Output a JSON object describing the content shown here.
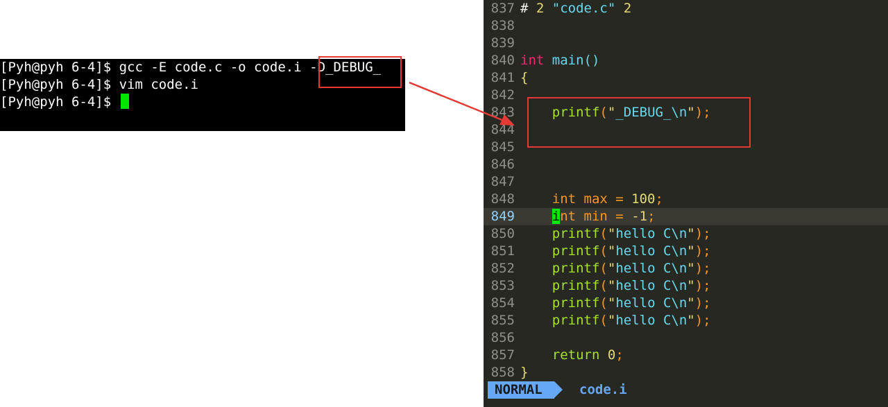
{
  "terminal": {
    "lines": [
      {
        "prompt": "[Pyh@pyh 6-4]$ ",
        "command": "gcc -E code.c -o code.i ",
        "highlight": "-D_DEBUG_"
      },
      {
        "prompt": "[Pyh@pyh 6-4]$ ",
        "command": "vim code.i",
        "highlight": ""
      },
      {
        "prompt": "[Pyh@pyh 6-4]$ ",
        "command": "",
        "highlight": ""
      }
    ]
  },
  "editor": {
    "lines": [
      {
        "num": "837",
        "tokens": [
          {
            "t": "# ",
            "c": "dir"
          },
          {
            "t": "2",
            "c": "num"
          },
          {
            "t": " \"code.c\" ",
            "c": "str"
          },
          {
            "t": "2",
            "c": "num"
          }
        ]
      },
      {
        "num": "838",
        "tokens": []
      },
      {
        "num": "839",
        "tokens": []
      },
      {
        "num": "840",
        "tokens": [
          {
            "t": "int",
            "c": "kw"
          },
          {
            "t": " ",
            "c": "plain"
          },
          {
            "t": "main",
            "c": "fn2"
          },
          {
            "t": "()",
            "c": "fn2"
          }
        ]
      },
      {
        "num": "841",
        "tokens": [
          {
            "t": "{",
            "c": "num"
          }
        ]
      },
      {
        "num": "842",
        "tokens": []
      },
      {
        "num": "843",
        "tokens": [
          {
            "t": "    ",
            "c": "plain"
          },
          {
            "t": "printf",
            "c": "fn"
          },
          {
            "t": "(",
            "c": "paren"
          },
          {
            "t": "\"",
            "c": "q"
          },
          {
            "t": "_DEBUG_\\n",
            "c": "str"
          },
          {
            "t": "\"",
            "c": "q"
          },
          {
            "t": ");",
            "c": "paren"
          }
        ]
      },
      {
        "num": "844",
        "tokens": []
      },
      {
        "num": "845",
        "tokens": []
      },
      {
        "num": "846",
        "tokens": []
      },
      {
        "num": "847",
        "tokens": []
      },
      {
        "num": "848",
        "tokens": [
          {
            "t": "    ",
            "c": "plain"
          },
          {
            "t": "int",
            "c": "type"
          },
          {
            "t": " max = ",
            "c": "type"
          },
          {
            "t": "100",
            "c": "num"
          },
          {
            "t": ";",
            "c": "paren"
          }
        ]
      },
      {
        "num": "849",
        "current": true,
        "tokens": [
          {
            "t": "    ",
            "c": "plain"
          },
          {
            "t": "i",
            "c": "cursor"
          },
          {
            "t": "nt",
            "c": "type"
          },
          {
            "t": " min = ",
            "c": "type"
          },
          {
            "t": "-1",
            "c": "num"
          },
          {
            "t": ";",
            "c": "paren"
          }
        ]
      },
      {
        "num": "850",
        "tokens": [
          {
            "t": "    ",
            "c": "plain"
          },
          {
            "t": "printf",
            "c": "fn"
          },
          {
            "t": "(",
            "c": "paren"
          },
          {
            "t": "\"",
            "c": "q"
          },
          {
            "t": "hello C\\n",
            "c": "str"
          },
          {
            "t": "\"",
            "c": "q"
          },
          {
            "t": ");",
            "c": "paren"
          }
        ]
      },
      {
        "num": "851",
        "tokens": [
          {
            "t": "    ",
            "c": "plain"
          },
          {
            "t": "printf",
            "c": "fn"
          },
          {
            "t": "(",
            "c": "paren"
          },
          {
            "t": "\"",
            "c": "q"
          },
          {
            "t": "hello C\\n",
            "c": "str"
          },
          {
            "t": "\"",
            "c": "q"
          },
          {
            "t": ");",
            "c": "paren"
          }
        ]
      },
      {
        "num": "852",
        "tokens": [
          {
            "t": "    ",
            "c": "plain"
          },
          {
            "t": "printf",
            "c": "fn"
          },
          {
            "t": "(",
            "c": "paren"
          },
          {
            "t": "\"",
            "c": "q"
          },
          {
            "t": "hello C\\n",
            "c": "str"
          },
          {
            "t": "\"",
            "c": "q"
          },
          {
            "t": ");",
            "c": "paren"
          }
        ]
      },
      {
        "num": "853",
        "tokens": [
          {
            "t": "    ",
            "c": "plain"
          },
          {
            "t": "printf",
            "c": "fn"
          },
          {
            "t": "(",
            "c": "paren"
          },
          {
            "t": "\"",
            "c": "q"
          },
          {
            "t": "hello C\\n",
            "c": "str"
          },
          {
            "t": "\"",
            "c": "q"
          },
          {
            "t": ");",
            "c": "paren"
          }
        ]
      },
      {
        "num": "854",
        "tokens": [
          {
            "t": "    ",
            "c": "plain"
          },
          {
            "t": "printf",
            "c": "fn"
          },
          {
            "t": "(",
            "c": "paren"
          },
          {
            "t": "\"",
            "c": "q"
          },
          {
            "t": "hello C\\n",
            "c": "str"
          },
          {
            "t": "\"",
            "c": "q"
          },
          {
            "t": ");",
            "c": "paren"
          }
        ]
      },
      {
        "num": "855",
        "tokens": [
          {
            "t": "    ",
            "c": "plain"
          },
          {
            "t": "printf",
            "c": "fn"
          },
          {
            "t": "(",
            "c": "paren"
          },
          {
            "t": "\"",
            "c": "q"
          },
          {
            "t": "hello C\\n",
            "c": "str"
          },
          {
            "t": "\"",
            "c": "q"
          },
          {
            "t": ");",
            "c": "paren"
          }
        ]
      },
      {
        "num": "856",
        "tokens": []
      },
      {
        "num": "857",
        "tokens": [
          {
            "t": "    ",
            "c": "plain"
          },
          {
            "t": "return",
            "c": "fn"
          },
          {
            "t": " ",
            "c": "plain"
          },
          {
            "t": "0",
            "c": "num"
          },
          {
            "t": ";",
            "c": "paren"
          }
        ]
      },
      {
        "num": "858",
        "tokens": [
          {
            "t": "}",
            "c": "num"
          }
        ]
      }
    ],
    "status": {
      "mode": "NORMAL",
      "file": "code.i"
    }
  },
  "colors": {
    "annotation": "#e53935",
    "cursor": "#00e800",
    "mode_badge": "#65a8f7"
  }
}
